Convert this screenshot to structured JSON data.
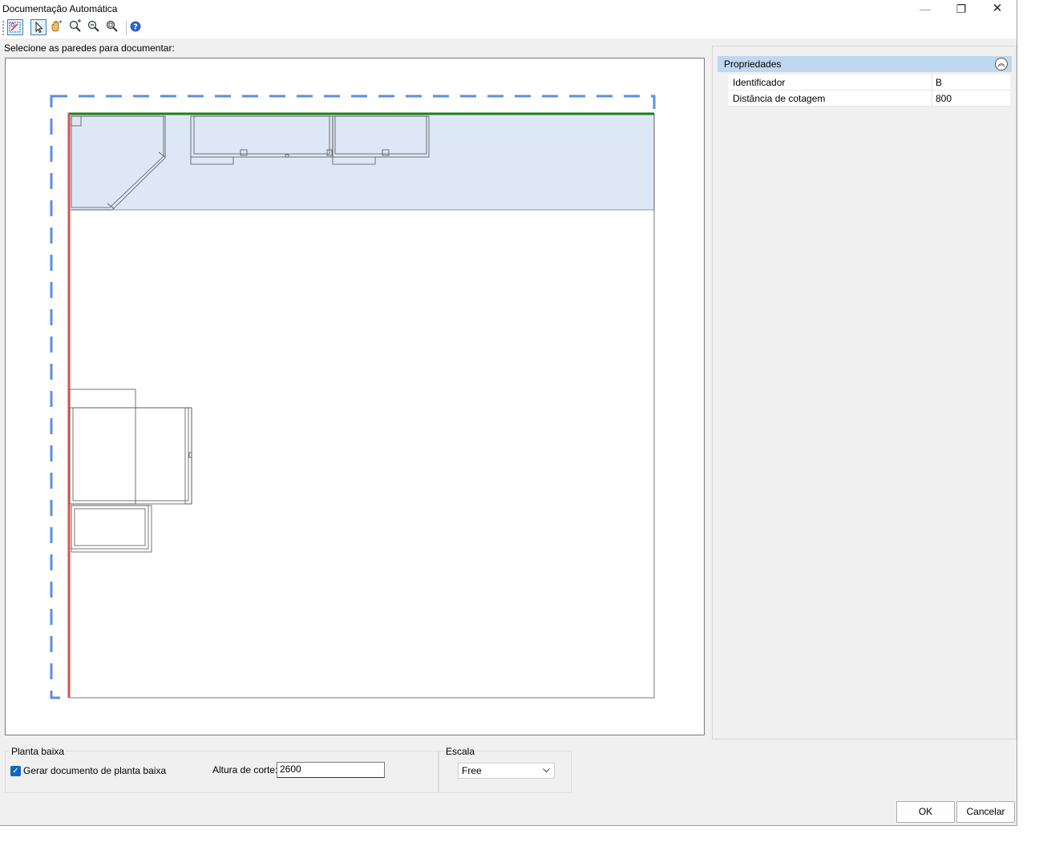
{
  "window": {
    "title": "Documentação Automática",
    "minimize_glyph": "—",
    "restore_glyph": "❐",
    "close_glyph": "✕"
  },
  "toolbar": {
    "icons": [
      "select-walls-icon",
      "pointer-icon",
      "pan-hand-icon",
      "zoom-window-icon",
      "zoom-out-icon",
      "zoom-extents-icon",
      "help-icon"
    ]
  },
  "prompt": "Selecione as paredes para documentar:",
  "properties": {
    "header": "Propriedades",
    "rows": [
      {
        "label": "Identificador",
        "value": "B"
      },
      {
        "label": "Distância de cotagem",
        "value": "800"
      }
    ]
  },
  "planta_baixa": {
    "legend": "Planta baixa",
    "checkbox_label": "Gerar documento de planta baixa",
    "checked": true,
    "altura_label": "Altura de corte:",
    "altura_value": "2600"
  },
  "escala": {
    "legend": "Escala",
    "selected": "Free"
  },
  "buttons": {
    "ok": "OK",
    "cancel": "Cancelar"
  },
  "colors": {
    "selected_wall": "#d9534f",
    "highlight_wall": "#1a7f1a",
    "selection_dash": "#5b8fe0",
    "highlight_fill": "#dde7f6"
  }
}
